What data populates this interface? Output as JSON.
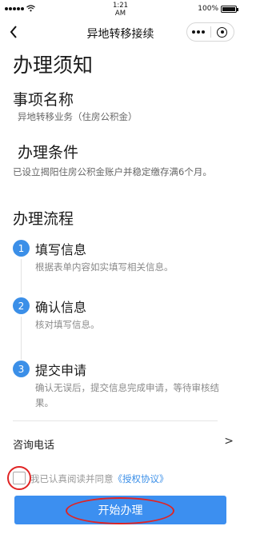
{
  "status_bar": {
    "time": "1:21\nAM",
    "battery": "100%",
    "battery_level": 1.0
  },
  "nav": {
    "title": "异地转移接续"
  },
  "page": {
    "title": "办理须知",
    "item_name": {
      "title": "事项名称",
      "text": "异地转移业务（住房公积金）"
    },
    "conditions": {
      "title": "办理条件",
      "text": "已设立揭阳住房公积金账户并稳定缴存满6个月。"
    },
    "process": {
      "title": "办理流程",
      "steps": [
        {
          "num": "1",
          "title": "填写信息",
          "desc": "根据表单内容如实填写相关信息。"
        },
        {
          "num": "2",
          "title": "确认信息",
          "desc": "核对填写信息。"
        },
        {
          "num": "3",
          "title": "提交申请",
          "desc": "确认无误后，提交信息完成申请，等待审核结果。"
        }
      ]
    },
    "consult": {
      "label": "咨询电话",
      "arrow": ">"
    },
    "agreement": {
      "text": "我已认真阅读并同意",
      "link": "《授权协议》",
      "checked": false
    },
    "start_button": "开始办理"
  },
  "colors": {
    "accent": "#3c8ff0",
    "annotation": "#e02424"
  },
  "icons": [
    "back-arrow-icon",
    "more-dots-icon",
    "close-target-icon",
    "wifi-icon",
    "signal-icon",
    "battery-icon",
    "chevron-right-icon"
  ]
}
